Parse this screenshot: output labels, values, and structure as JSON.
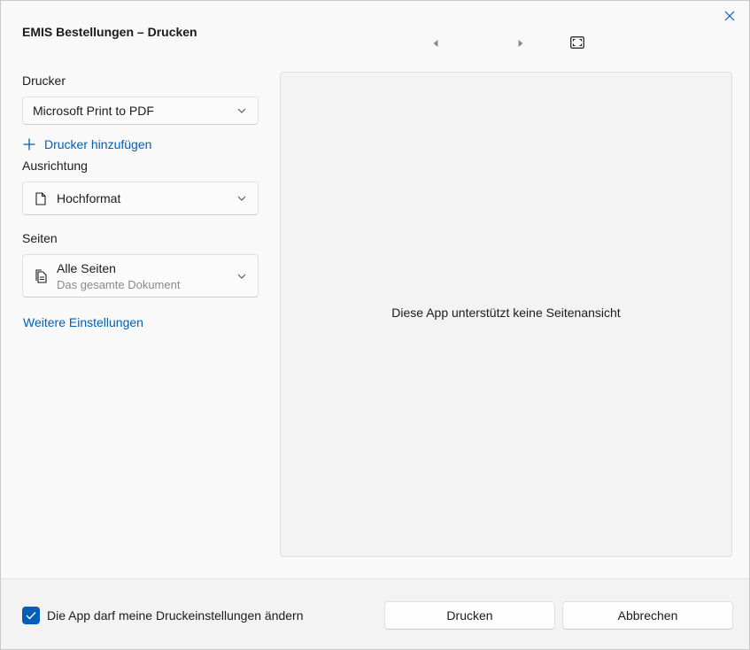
{
  "window": {
    "title": "EMIS Bestellungen – Drucken"
  },
  "navigation": {
    "prev_icon": "caret-left-icon",
    "next_icon": "caret-right-icon",
    "fit_icon": "fit-to-window-icon",
    "close_icon": "close-icon"
  },
  "printer": {
    "label": "Drucker",
    "value": "Microsoft Print to PDF",
    "add_label": "Drucker hinzufügen"
  },
  "orientation": {
    "label": "Ausrichtung",
    "value": "Hochformat",
    "icon": "page-icon"
  },
  "pages": {
    "label": "Seiten",
    "value": "Alle Seiten",
    "subtext": "Das gesamte Dokument",
    "icon": "pages-icon"
  },
  "more_settings": "Weitere Einstellungen",
  "preview": {
    "message": "Diese App unterstützt keine Seitenansicht"
  },
  "footer": {
    "checkbox_label": "Die App darf meine Druckeinstellungen ändern",
    "checkbox_checked": true,
    "print_label": "Drucken",
    "cancel_label": "Abbrechen"
  },
  "colors": {
    "accent": "#005fb8",
    "background": "#f9f9f9",
    "footer": "#f3f3f3"
  }
}
